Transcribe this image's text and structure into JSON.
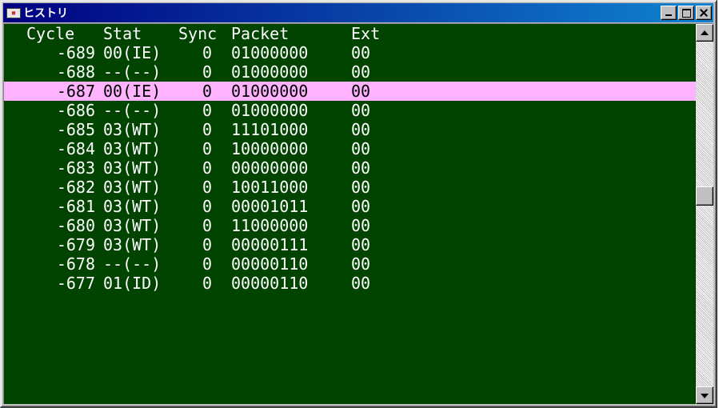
{
  "window": {
    "title": "ヒストリ",
    "icon": "history-window-icon",
    "controls": [
      "minimize-icon",
      "maximize-icon",
      "close-icon"
    ]
  },
  "columns": {
    "cycle": "Cycle",
    "stat": "Stat",
    "sync": "Sync",
    "packet": "Packet",
    "ext": "Ext"
  },
  "rows": [
    {
      "cycle": "-689",
      "stat": "00(IE)",
      "sync": "0",
      "packet": "01000000",
      "ext": "00"
    },
    {
      "cycle": "-688",
      "stat": "--(--)",
      "sync": "0",
      "packet": "01000000",
      "ext": "00"
    },
    {
      "cycle": "-687",
      "stat": "00(IE)",
      "sync": "0",
      "packet": "01000000",
      "ext": "00"
    },
    {
      "cycle": "-686",
      "stat": "--(--)",
      "sync": "0",
      "packet": "01000000",
      "ext": "00"
    },
    {
      "cycle": "-685",
      "stat": "03(WT)",
      "sync": "0",
      "packet": "11101000",
      "ext": "00"
    },
    {
      "cycle": "-684",
      "stat": "03(WT)",
      "sync": "0",
      "packet": "10000000",
      "ext": "00"
    },
    {
      "cycle": "-683",
      "stat": "03(WT)",
      "sync": "0",
      "packet": "00000000",
      "ext": "00"
    },
    {
      "cycle": "-682",
      "stat": "03(WT)",
      "sync": "0",
      "packet": "10011000",
      "ext": "00"
    },
    {
      "cycle": "-681",
      "stat": "03(WT)",
      "sync": "0",
      "packet": "00001011",
      "ext": "00"
    },
    {
      "cycle": "-680",
      "stat": "03(WT)",
      "sync": "0",
      "packet": "11000000",
      "ext": "00"
    },
    {
      "cycle": "-679",
      "stat": "03(WT)",
      "sync": "0",
      "packet": "00000111",
      "ext": "00"
    },
    {
      "cycle": "-678",
      "stat": "--(--)",
      "sync": "0",
      "packet": "00000110",
      "ext": "00"
    },
    {
      "cycle": "-677",
      "stat": "01(ID)",
      "sync": "0",
      "packet": "00000110",
      "ext": "00"
    }
  ],
  "selected_row_index": 2,
  "colors": {
    "background": "#004400",
    "text": "#ffffff",
    "selection": "#ffb3ff",
    "titlebar": "#000080"
  }
}
